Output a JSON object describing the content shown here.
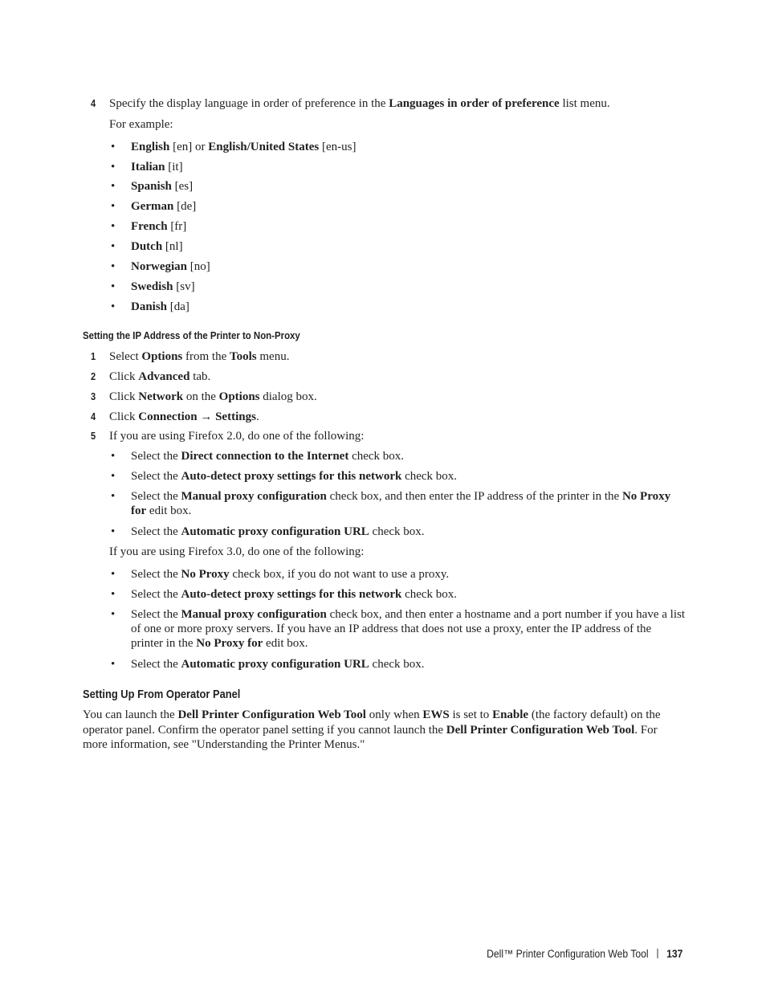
{
  "step4_languages": {
    "number": "4",
    "pre": "Specify the display language in order of preference in the ",
    "bold": "Languages in order of preference",
    "post": " list menu.",
    "example_label": "For example:",
    "languages": [
      {
        "name": "English",
        "code": "[en]",
        "alt_sep": " or ",
        "alt_name": "English/United States",
        "alt_code": "[en-us]"
      },
      {
        "name": "Italian",
        "code": "[it]"
      },
      {
        "name": "Spanish",
        "code": "[es]"
      },
      {
        "name": "German",
        "code": "[de]"
      },
      {
        "name": "French",
        "code": "[fr]"
      },
      {
        "name": "Dutch",
        "code": "[nl]"
      },
      {
        "name": "Norwegian",
        "code": "[no]"
      },
      {
        "name": "Swedish",
        "code": "[sv]"
      },
      {
        "name": "Danish",
        "code": "[da]"
      }
    ]
  },
  "section_nonproxy": {
    "heading": "Setting the IP Address of the Printer to Non-Proxy",
    "steps": [
      {
        "number": "1",
        "parts": [
          "Select ",
          "Options",
          " from the ",
          "Tools",
          " menu."
        ]
      },
      {
        "number": "2",
        "parts": [
          "Click ",
          "Advanced",
          " tab."
        ]
      },
      {
        "number": "3",
        "parts": [
          "Click ",
          "Network",
          " on the ",
          "Options",
          " dialog box."
        ]
      },
      {
        "number": "4",
        "parts": [
          "Click ",
          "Connection",
          " → ",
          "Settings",
          "."
        ]
      },
      {
        "number": "5",
        "text": "If you are using Firefox 2.0, do one of the following:"
      }
    ],
    "firefox2_options": [
      {
        "pre": "Select the ",
        "bold": "Direct connection to the Internet",
        "post": " check box."
      },
      {
        "pre": "Select the ",
        "bold": "Auto-detect proxy settings for this network",
        "post": " check box."
      },
      {
        "pre": "Select the ",
        "bold": "Manual proxy configuration",
        "mid": " check box, and then enter the IP address of the printer in the ",
        "bold2": "No Proxy for",
        "post": " edit box."
      },
      {
        "pre": "Select the ",
        "bold": "Automatic proxy configuration URL",
        "post": " check box."
      }
    ],
    "firefox3_intro": "If you are using Firefox 3.0, do one of the following:",
    "firefox3_options": [
      {
        "pre": "Select the ",
        "bold": "No Proxy",
        "post": " check box, if you do not want to use a proxy."
      },
      {
        "pre": "Select the ",
        "bold": "Auto-detect proxy settings for this network",
        "post": " check box."
      },
      {
        "pre": "Select the ",
        "bold": "Manual proxy configuration",
        "mid": " check box, and then enter a hostname and a port number if you have a list of one or more proxy servers. If you have an IP address that does not use a proxy, enter the IP address of the printer in the ",
        "bold2": "No Proxy for",
        "post": " edit box."
      },
      {
        "pre": "Select the ",
        "bold": "Automatic proxy configuration URL",
        "post": " check box."
      }
    ]
  },
  "section_operator": {
    "heading": "Setting Up From Operator Panel",
    "parts": [
      "You can launch the ",
      "Dell Printer Configuration Web Tool",
      " only when ",
      "EWS",
      " is set to ",
      "Enable",
      " (the factory default) on the operator panel. Confirm the operator panel setting if you cannot launch the ",
      "Dell Printer Configuration Web Tool",
      ". For more information, see \"Understanding the Printer Menus.\""
    ]
  },
  "footer": {
    "title": "Dell™ Printer Configuration Web Tool",
    "page_number": "137"
  },
  "bullet_char": "•"
}
